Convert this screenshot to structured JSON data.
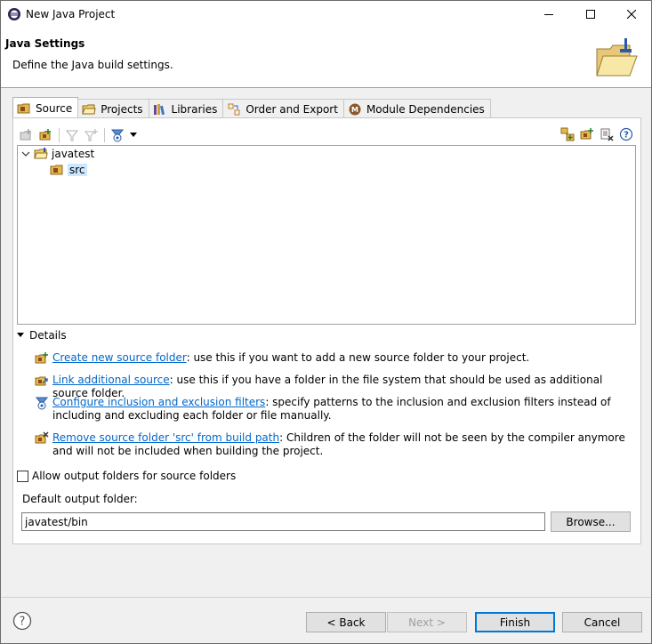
{
  "window": {
    "title": "New Java Project"
  },
  "banner": {
    "title": "Java Settings",
    "description": "Define the Java build settings."
  },
  "tabs": [
    {
      "label": "Source",
      "icon": "source-folder-icon",
      "active": true
    },
    {
      "label": "Projects",
      "icon": "projects-icon",
      "active": false
    },
    {
      "label": "Libraries",
      "icon": "libraries-icon",
      "active": false
    },
    {
      "label": "Order and Export",
      "icon": "order-export-icon",
      "active": false
    },
    {
      "label": "Module Dependencies",
      "icon": "module-icon",
      "active": false
    }
  ],
  "tree": {
    "root": "javatest",
    "child": "src"
  },
  "details": {
    "header": "Details",
    "items": [
      {
        "link": "Create new source folder",
        "text": ": use this if you want to add a new source folder to your project."
      },
      {
        "link": "Link additional source",
        "text": ": use this if you have a folder in the file system that should be used as additional source folder."
      },
      {
        "link": "Configure inclusion and exclusion filters",
        "text": ": specify patterns to the inclusion and exclusion filters instead of including and excluding each folder or file manually."
      },
      {
        "link": "Remove source folder 'src' from build path",
        "text": ": Children of the folder will not be seen by the compiler anymore and will not be included when building the project."
      }
    ]
  },
  "options": {
    "allow_output_folders": "Allow output folders for source folders",
    "default_output_label": "Default output folder:",
    "default_output_value": "javatest/bin",
    "browse": "Browse..."
  },
  "footer": {
    "back": "< Back",
    "next": "Next >",
    "finish": "Finish",
    "cancel": "Cancel"
  },
  "colors": {
    "link": "#0066cc",
    "selection": "#cce8ff",
    "accent": "#0078d7"
  }
}
